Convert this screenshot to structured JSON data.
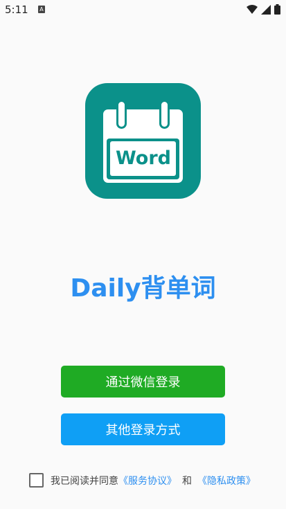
{
  "status_bar": {
    "time": "5:11",
    "notification_icon_letter": "A"
  },
  "app": {
    "name": "Daily背单词",
    "logo_text": "Word",
    "logo_color": "#0b918a"
  },
  "buttons": {
    "wechat_login": "通过微信登录",
    "other_login": "其他登录方式"
  },
  "agreement": {
    "prefix": "我已阅读并同意",
    "service_link": "《服务协议》",
    "and": "和",
    "privacy_link": "《隐私政策》",
    "checked": false
  },
  "colors": {
    "wechat": "#1fab24",
    "other": "#0f9ff5",
    "brand_text": "#2d8ff0"
  }
}
